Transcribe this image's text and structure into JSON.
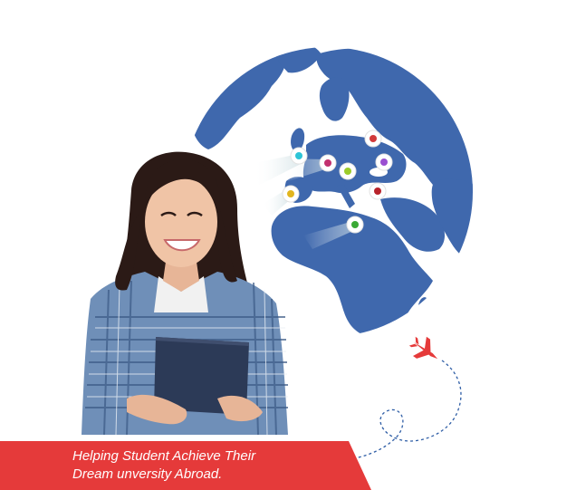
{
  "banner": {
    "line1": "Helping Student Achieve Their",
    "line2": "Dream unversity Abroad."
  },
  "colors": {
    "globe": "#3f68ad",
    "banner": "#e53a3a",
    "airplane": "#e53a3a",
    "flight_path": "#2f5ea6"
  },
  "icons": [
    "globe-illustration",
    "student-photo",
    "location-pin-icon",
    "airplane-icon",
    "dashed-flight-path"
  ],
  "pins": [
    {
      "name": "pin-cyan",
      "color": "#2ec4d6"
    },
    {
      "name": "pin-red",
      "color": "#d23a3a"
    },
    {
      "name": "pin-magenta",
      "color": "#c2306e"
    },
    {
      "name": "pin-lime",
      "color": "#9ccc2a"
    },
    {
      "name": "pin-purple",
      "color": "#9a4fd1"
    },
    {
      "name": "pin-yellow",
      "color": "#e2b51d"
    },
    {
      "name": "pin-darkred",
      "color": "#b8222a"
    },
    {
      "name": "pin-green",
      "color": "#3aa935"
    }
  ]
}
